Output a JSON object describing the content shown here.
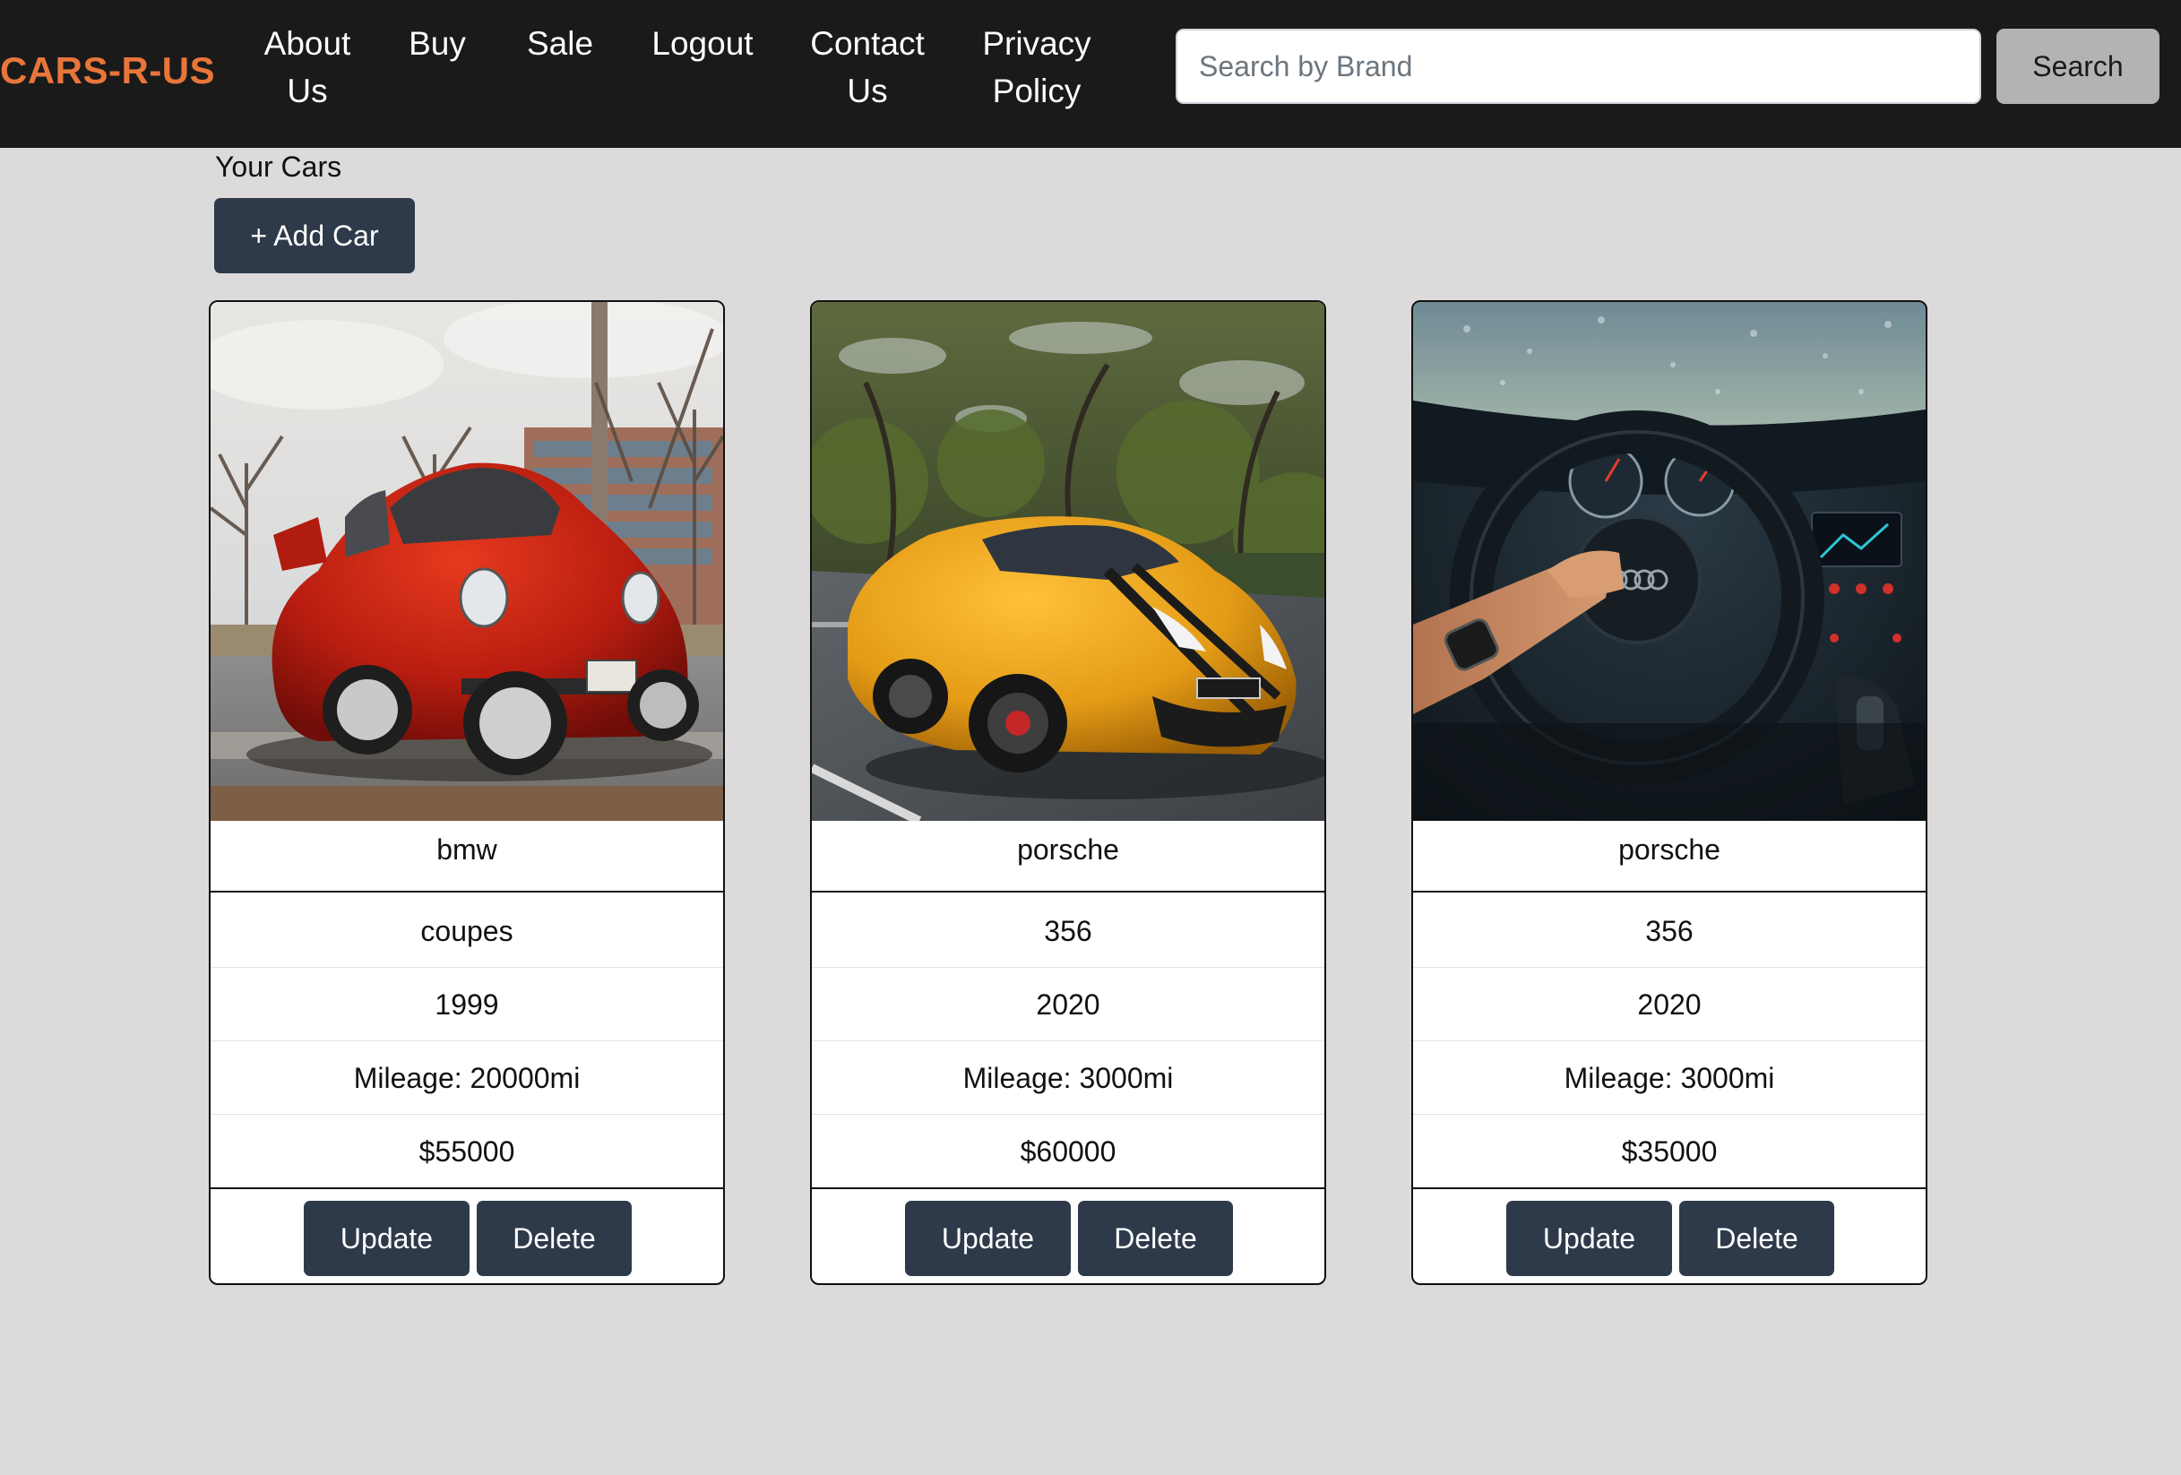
{
  "navbar": {
    "brand": "CARS-R-US",
    "links": {
      "about_line1": "About",
      "about_line2": "Us",
      "buy": "Buy",
      "sale": "Sale",
      "logout": "Logout",
      "contact_line1": "Contact",
      "contact_line2": "Us",
      "privacy_line1": "Privacy",
      "privacy_line2": "Policy"
    },
    "search": {
      "placeholder": "Search by Brand",
      "button_label": "Search"
    }
  },
  "page": {
    "heading": "Your Cars",
    "add_car_label": "+ Add Car"
  },
  "cards": [
    {
      "brand": "bmw",
      "model": "coupes",
      "year": "1999",
      "mileage": "Mileage: 20000mi",
      "price": "$55000",
      "update_label": "Update",
      "delete_label": "Delete"
    },
    {
      "brand": "porsche",
      "model": "356",
      "year": "2020",
      "mileage": "Mileage: 3000mi",
      "price": "$60000",
      "update_label": "Update",
      "delete_label": "Delete"
    },
    {
      "brand": "porsche",
      "model": "356",
      "year": "2020",
      "mileage": "Mileage: 3000mi",
      "price": "$35000",
      "update_label": "Update",
      "delete_label": "Delete"
    }
  ],
  "colors": {
    "navbar_bg": "#1a1a1a",
    "brand": "#e8763a",
    "page_bg": "#dcdadb",
    "button_dark": "#2e3a49",
    "search_button_bg": "#b3b3b3"
  }
}
